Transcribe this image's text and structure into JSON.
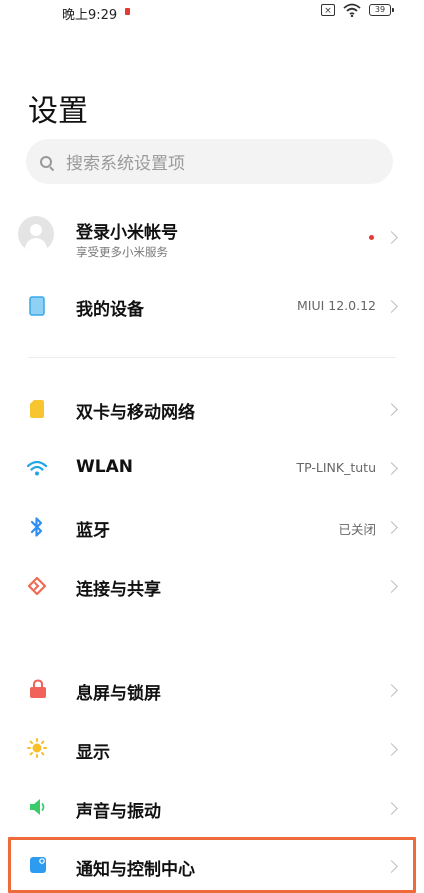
{
  "status_bar": {
    "time": "晚上9:29",
    "sim_symbol": "×",
    "battery": "39"
  },
  "page": {
    "title": "设置"
  },
  "search": {
    "placeholder": "搜索系统设置项"
  },
  "account": {
    "title": "登录小米帐号",
    "subtitle": "享受更多小米服务"
  },
  "device": {
    "title": "我的设备",
    "value": "MIUI 12.0.12"
  },
  "network": [
    {
      "title": "双卡与移动网络",
      "value": ""
    },
    {
      "title": "WLAN",
      "value": "TP-LINK_tutu"
    },
    {
      "title": "蓝牙",
      "value": "已关闭"
    },
    {
      "title": "连接与共享",
      "value": ""
    }
  ],
  "personal": [
    {
      "title": "息屏与锁屏"
    },
    {
      "title": "显示"
    },
    {
      "title": "声音与振动"
    },
    {
      "title": "通知与控制中心"
    }
  ],
  "colors": {
    "sim": "#f6c530",
    "wifi": "#23a6e6",
    "bluetooth": "#2f8ff0",
    "share": "#ef6a55",
    "lock": "#f0625a",
    "display": "#f7c02b",
    "sound": "#3ccb6a",
    "notification": "#2d9bf0",
    "highlight": "#ef6a3a"
  }
}
